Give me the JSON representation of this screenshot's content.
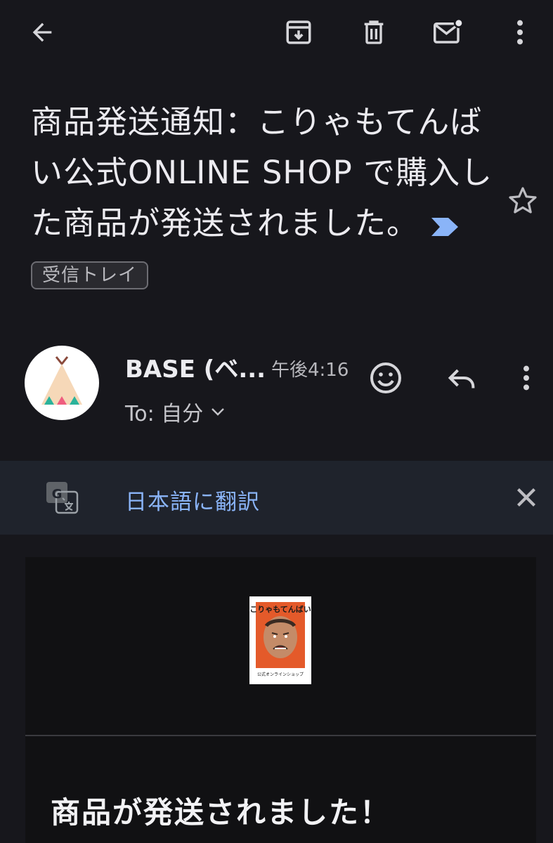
{
  "message": {
    "subject": "商品発送通知：こりゃもてんばい公式ONLINE SHOP で購入した商品が発送されました。",
    "label": "受信トレイ"
  },
  "sender": {
    "name": "BASE (ベ...",
    "time": "午後4:16",
    "to": "To: 自分"
  },
  "translate": {
    "link": "日本語に翻訳"
  },
  "email_body": {
    "logo_text": "こりゃもてんばい",
    "logo_subtext": "公式オンラインショップ",
    "heading": "商品が発送されました！"
  },
  "colors": {
    "background": "#17171c",
    "translate_bar": "#1f232c",
    "link": "#8ab4f8",
    "label_arrow": "#8ab4f8"
  }
}
